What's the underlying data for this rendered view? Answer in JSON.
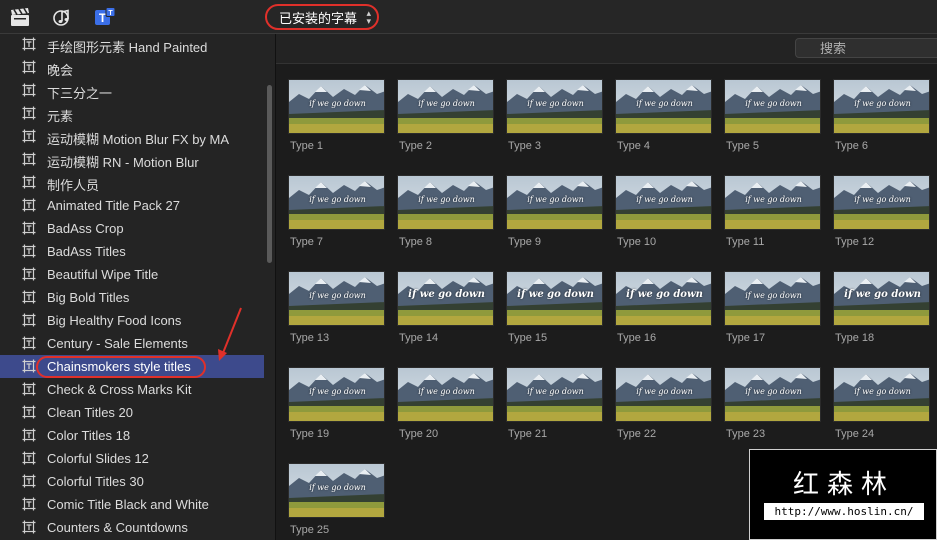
{
  "toolbar": {
    "icons": [
      "clapperboard-icon",
      "music-icon",
      "titles-icon"
    ],
    "category_select": "已安装的字幕"
  },
  "sidebar": {
    "items": [
      {
        "label": "手绘图形元素 Hand Painted"
      },
      {
        "label": "晚会"
      },
      {
        "label": "下三分之一"
      },
      {
        "label": "元素"
      },
      {
        "label": "运动模糊 Motion Blur FX by MA"
      },
      {
        "label": "运动模糊 RN - Motion Blur"
      },
      {
        "label": "制作人员"
      },
      {
        "label": "Animated Title Pack 27"
      },
      {
        "label": "BadAss Crop"
      },
      {
        "label": "BadAss Titles"
      },
      {
        "label": "Beautiful Wipe Title"
      },
      {
        "label": "Big Bold Titles"
      },
      {
        "label": "Big Healthy Food Icons"
      },
      {
        "label": "Century - Sale Elements"
      },
      {
        "label": "Chainsmokers style titles",
        "selected": true
      },
      {
        "label": "Check & Cross Marks Kit"
      },
      {
        "label": "Clean Titles 20"
      },
      {
        "label": "Color Titles 18"
      },
      {
        "label": "Colorful Slides 12"
      },
      {
        "label": "Colorful Titles 30"
      },
      {
        "label": "Comic Title Black and White"
      },
      {
        "label": "Counters & Countdowns"
      }
    ]
  },
  "search": {
    "placeholder": "搜索",
    "value": ""
  },
  "thumbnails": {
    "overlay_text": "if we go down",
    "items": [
      {
        "label": "Type 1"
      },
      {
        "label": "Type 2"
      },
      {
        "label": "Type 3"
      },
      {
        "label": "Type 4"
      },
      {
        "label": "Type 5"
      },
      {
        "label": "Type 6"
      },
      {
        "label": "Type 7"
      },
      {
        "label": "Type 8"
      },
      {
        "label": "Type 9"
      },
      {
        "label": "Type 10"
      },
      {
        "label": "Type 11"
      },
      {
        "label": "Type 12"
      },
      {
        "label": "Type 13"
      },
      {
        "label": "Type 14"
      },
      {
        "label": "Type 15"
      },
      {
        "label": "Type 16"
      },
      {
        "label": "Type 17"
      },
      {
        "label": "Type 18"
      },
      {
        "label": "Type 19"
      },
      {
        "label": "Type 20"
      },
      {
        "label": "Type 21"
      },
      {
        "label": "Type 22"
      },
      {
        "label": "Type 23"
      },
      {
        "label": "Type 24"
      },
      {
        "label": "Type 25"
      }
    ]
  },
  "watermark": {
    "title": "红森林",
    "url": "http://www.hoslin.cn/"
  },
  "colors": {
    "accent_red": "#e0302a",
    "selection": "#3d4a8c",
    "titles_icon": "#3b6fe8"
  }
}
